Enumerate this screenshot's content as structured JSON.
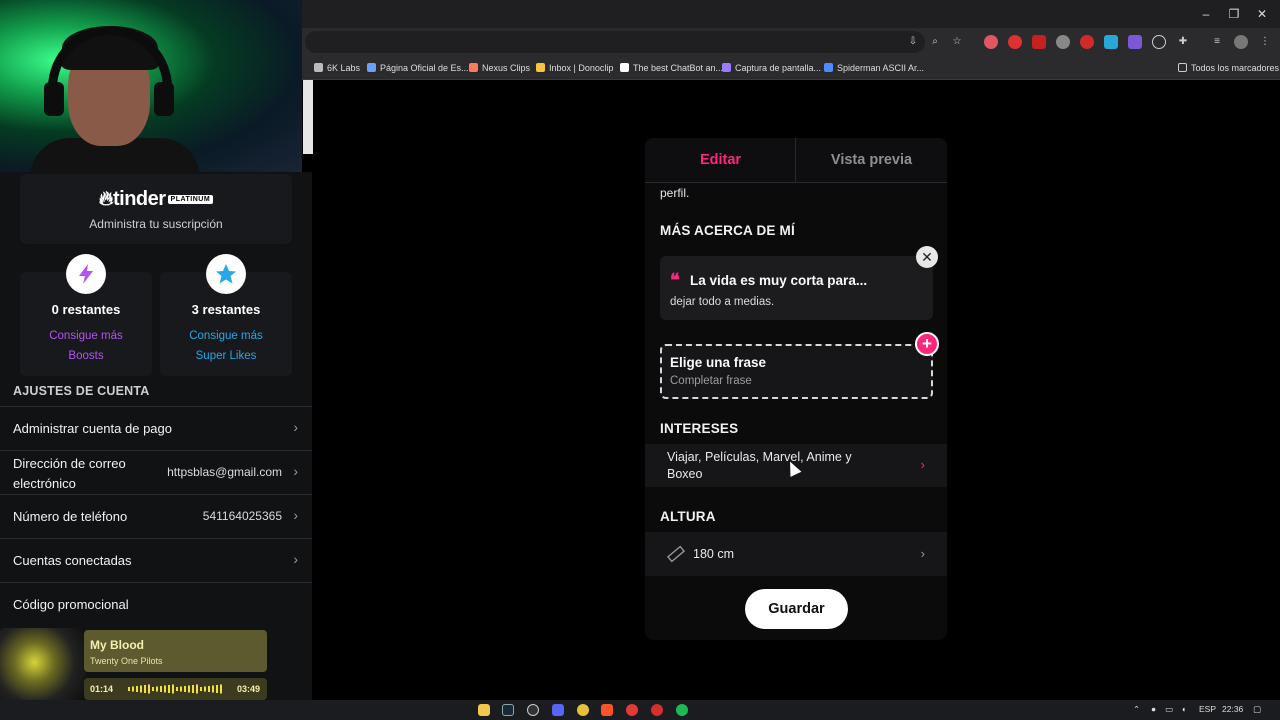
{
  "bookmarks": [
    {
      "label": "6K Labs",
      "color": "#bbbbbb"
    },
    {
      "label": "Página Oficial de Es...",
      "color": "#6aa0ff"
    },
    {
      "label": "Nexus Clips",
      "color": "#ff7a59"
    },
    {
      "label": "Inbox | Donoclip",
      "color": "#f5c542"
    },
    {
      "label": "The best ChatBot an...",
      "color": "#ffffff"
    },
    {
      "label": "Captura de pantalla...",
      "color": "#9b7bff"
    },
    {
      "label": "Spiderman ASCII Ar...",
      "color": "#4d8cff"
    }
  ],
  "all_bookmarks": "Todos los marcadores",
  "subscription": {
    "brand": "tinder",
    "tier": "PLATINUM",
    "manage": "Administra tu suscripción"
  },
  "boosts": {
    "count": "0 restantes",
    "cta_line1": "Consigue más",
    "cta_line2": "Boosts",
    "color": "#b453f3"
  },
  "superlikes": {
    "count": "3 restantes",
    "cta_line1": "Consigue más",
    "cta_line2": "Super Likes",
    "color": "#27a7e7"
  },
  "account": {
    "heading": "AJUSTES DE CUENTA",
    "rows": [
      {
        "label": "Administrar cuenta de pago",
        "value": ""
      },
      {
        "label": "Dirección de correo",
        "label2": "electrónico",
        "value": "httpsblas@gmail.com"
      },
      {
        "label": "Número de teléfono",
        "value": "541164025365"
      },
      {
        "label": "Cuentas conectadas",
        "value": ""
      },
      {
        "label": "Código promocional",
        "value": ""
      }
    ]
  },
  "player": {
    "title": "My Blood",
    "artist": "Twenty One Pilots",
    "elapsed": "01:14",
    "total": "03:49",
    "progress": 0.33
  },
  "editor": {
    "tabs": {
      "edit": "Editar",
      "preview": "Vista previa"
    },
    "accent": "#fd267d",
    "clipped_text": "perfil.",
    "about_heading": "MÁS ACERCA DE MÍ",
    "prompt": {
      "quote": "❝",
      "title": "La vida es muy corta para...",
      "answer": "dejar todo a medias."
    },
    "choose": {
      "title": "Elige una frase",
      "sub": "Completar frase"
    },
    "interests_heading": "INTERESES",
    "interests_line1": "Viajar, Películas, Marvel, Anime y",
    "interests_line2": "Boxeo",
    "height_heading": "ALTURA",
    "height_value": "180 cm",
    "save": "Guardar"
  },
  "taskbar": {
    "lang": "ESP",
    "time": "22:36"
  }
}
